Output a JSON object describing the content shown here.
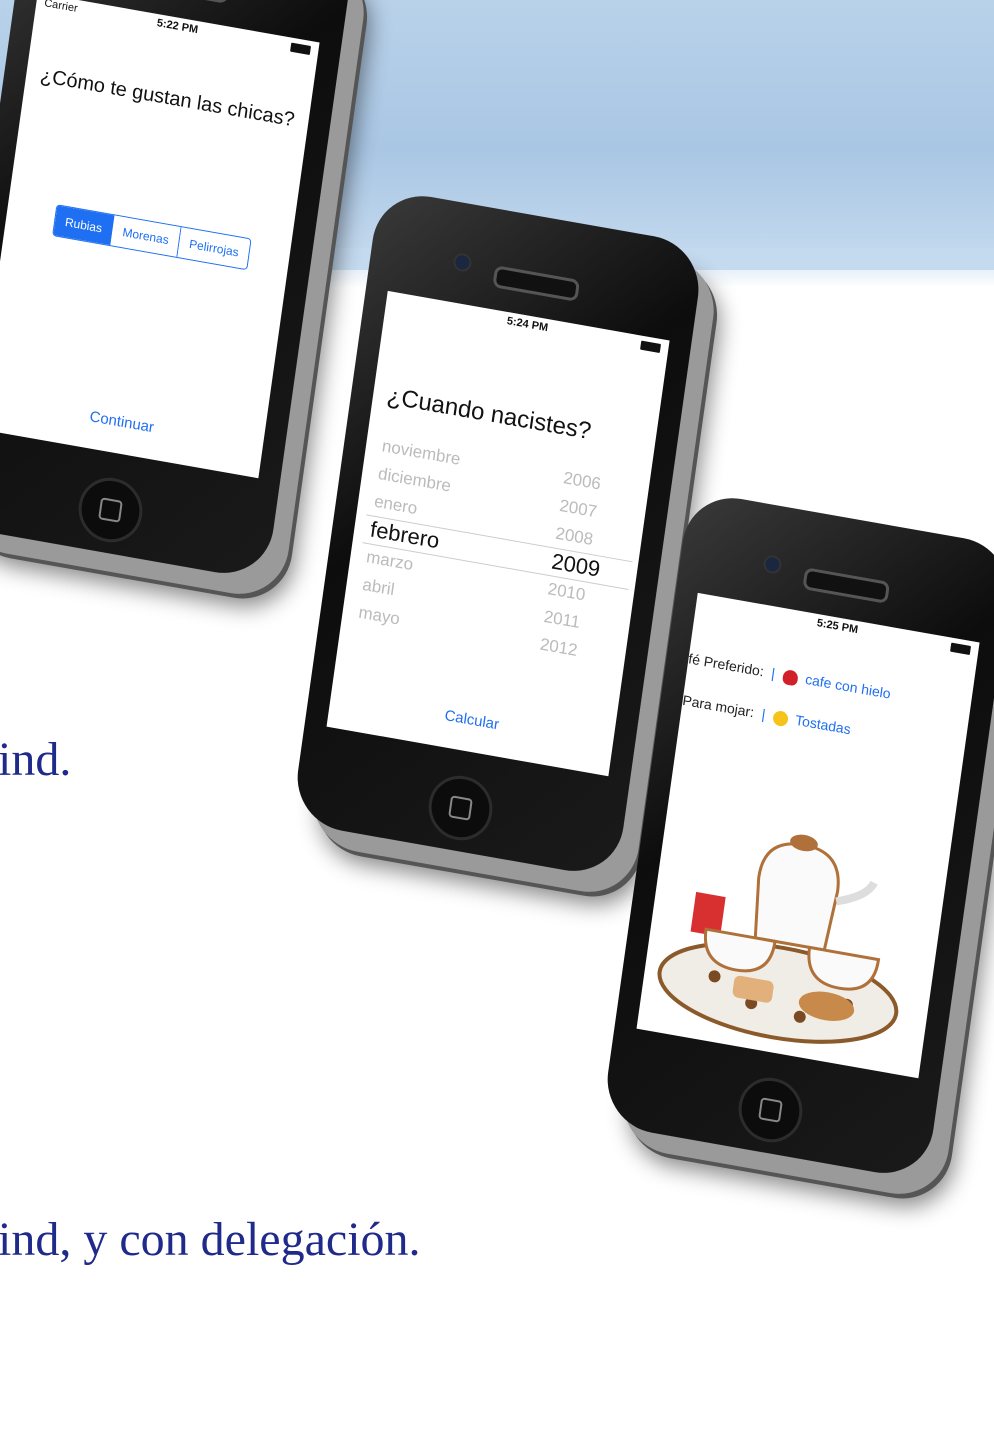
{
  "slide": {
    "text_line1": "ind.",
    "text_line2": "ind, y con delegación."
  },
  "phone1": {
    "carrier": "Carrier",
    "time": "5:22 PM",
    "question": "¿Cómo te gustan las chicas?",
    "segments": [
      "Rubias",
      "Morenas",
      "Pelirrojas"
    ],
    "selected_segment": "Rubias",
    "button": "Continuar"
  },
  "phone2": {
    "time": "5:24 PM",
    "question": "¿Cuando nacistes?",
    "months": [
      "noviembre",
      "diciembre",
      "enero",
      "febrero",
      "marzo",
      "abril",
      "mayo"
    ],
    "years": [
      "2006",
      "2007",
      "2008",
      "2009",
      "2010",
      "2011",
      "2012"
    ],
    "selected_month": "febrero",
    "selected_year": "2009",
    "button": "Calcular"
  },
  "phone3": {
    "time": "5:25 PM",
    "row1_label": "fé Preferido:",
    "row1_value": "cafe con hielo",
    "row1_icon": "heart-icon",
    "row2_label": "Para mojar:",
    "row2_value": "Tostadas",
    "row2_icon": "smile-icon"
  },
  "colors": {
    "accent": "#1e6ff2",
    "slide_text": "#1f2a8a"
  }
}
